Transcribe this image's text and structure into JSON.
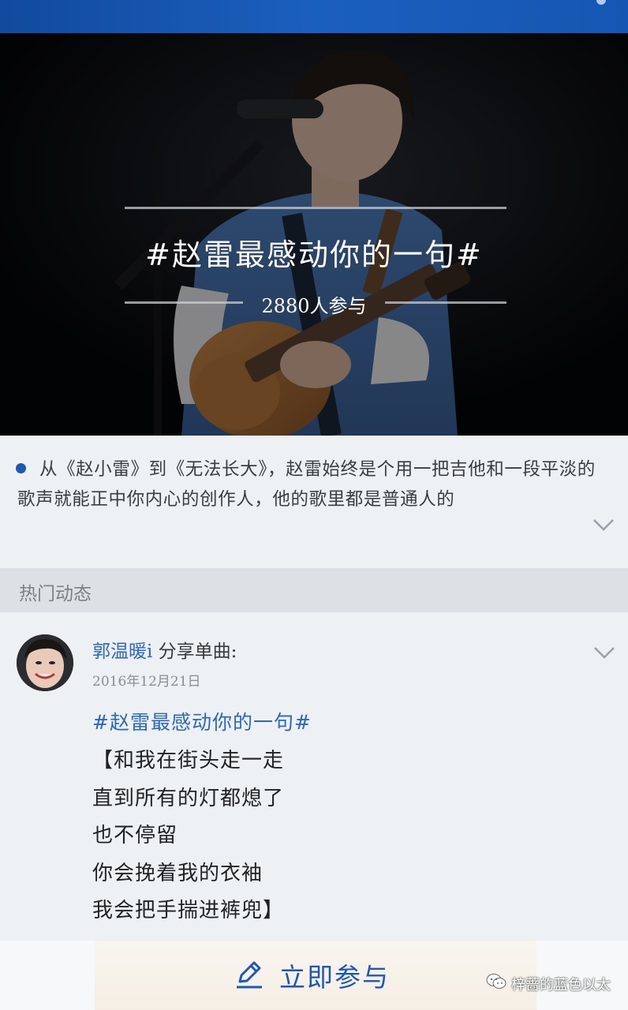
{
  "topic": {
    "title": "#赵雷最感动你的一句#",
    "participants": "2880人参与"
  },
  "description": {
    "text": "从《赵小雷》到《无法长大》，赵雷始终是个用一把吉他和一段平淡的歌声就能正中你内心的创作人，他的歌里都是普通人的"
  },
  "section": {
    "label": "热门动态"
  },
  "post": {
    "author": "郭温暖i",
    "action": " 分享单曲:",
    "date": "2016年12月21日",
    "hashtag": "#赵雷最感动你的一句#",
    "lyrics": [
      "【和我在街头走一走",
      "直到所有的灯都熄了",
      "也不停留",
      "你会挽着我的衣袖",
      "我会把手揣进裤兜】"
    ]
  },
  "footer": {
    "join_label": "立即参与",
    "watermark": "梓蔷的蓝色以太"
  },
  "colors": {
    "accent": "#1d58b8",
    "link": "#2c67c4",
    "topbar": "#1656b3"
  },
  "icons": {
    "expand": "chevron-down-icon",
    "post_menu": "chevron-down-icon",
    "join": "pencil-icon",
    "watermark": "wechat-icon"
  }
}
